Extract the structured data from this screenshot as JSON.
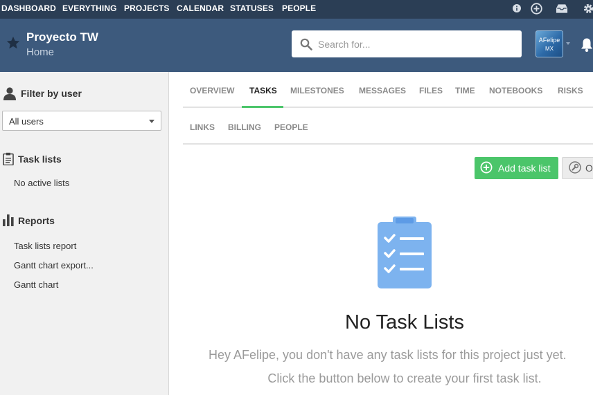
{
  "topnav": {
    "items": [
      "DASHBOARD",
      "EVERYTHING",
      "PROJECTS",
      "CALENDAR",
      "STATUSES",
      "PEOPLE"
    ],
    "icons": [
      "info-icon",
      "plus-circle-icon",
      "inbox-icon",
      "gear-icon"
    ]
  },
  "project": {
    "title": "Proyecto TW",
    "subtitle": "Home"
  },
  "search": {
    "placeholder": "Search for..."
  },
  "user": {
    "avatar_line1": "AFelipe",
    "avatar_line2": "MX"
  },
  "sidebar": {
    "filter_heading": "Filter by user",
    "filter_value": "All users",
    "tasklists_heading": "Task lists",
    "tasklists_empty": "No active lists",
    "reports_heading": "Reports",
    "reports": [
      "Task lists report",
      "Gantt chart export...",
      "Gantt chart"
    ]
  },
  "tabs": {
    "row1": [
      "OVERVIEW",
      "TASKS",
      "MILESTONES",
      "MESSAGES",
      "FILES",
      "TIME",
      "NOTEBOOKS",
      "RISKS"
    ],
    "row2": [
      "LINKS",
      "BILLING",
      "PEOPLE"
    ],
    "active": "TASKS"
  },
  "actions": {
    "add_task_list": "Add task list",
    "options": "Options"
  },
  "empty": {
    "title": "No Task Lists",
    "line1": "Hey AFelipe, you don't have any task lists for this project just yet.",
    "line2": "Click the button below to create your first task list."
  },
  "colors": {
    "topnav_bg": "#2b3e55",
    "header_bg": "#3d5a7d",
    "accent_green": "#4bc56a",
    "clipboard_blue": "#7db3ef"
  }
}
